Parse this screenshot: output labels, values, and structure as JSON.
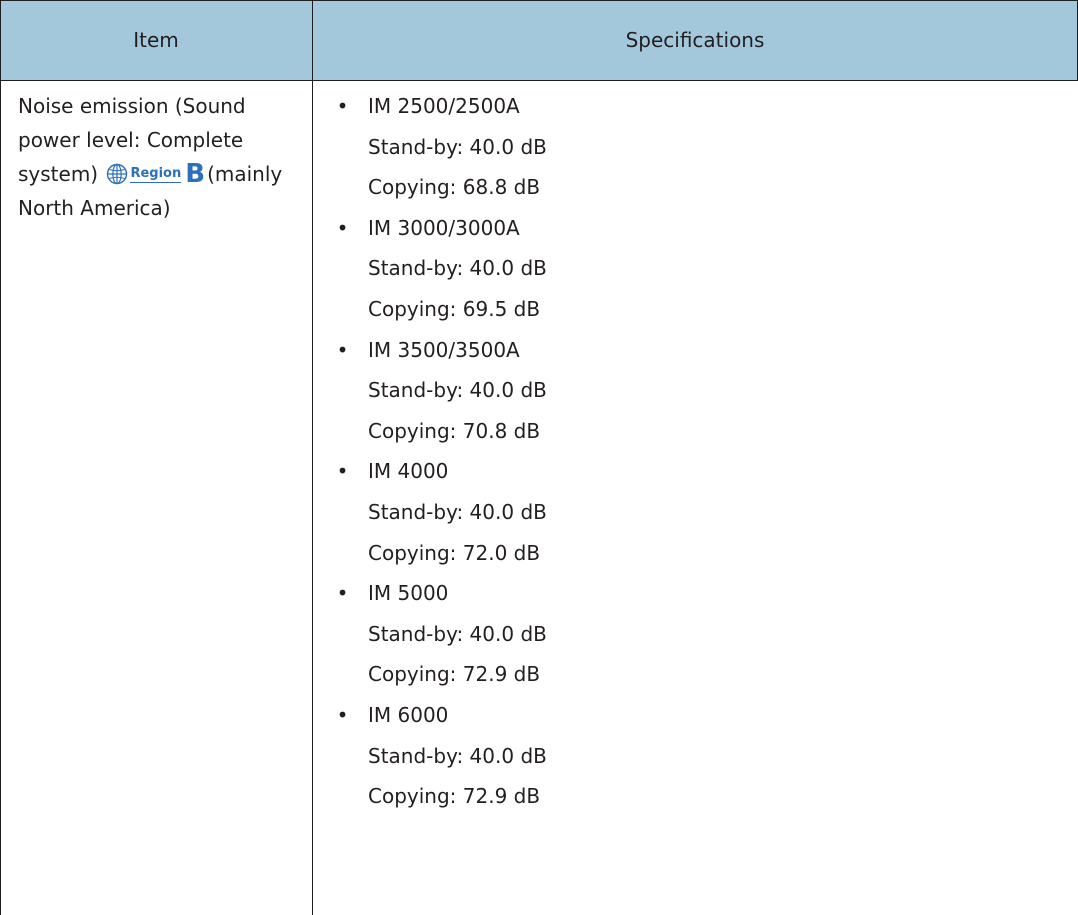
{
  "table": {
    "header": {
      "item": "Item",
      "specifications": "Specifications"
    },
    "item": {
      "lines": [
        "Noise emission (Sound",
        "power level: Complete"
      ],
      "before_badge": "system)",
      "region_word": "Region",
      "region_letter": "B",
      "after_badge": "(mainly",
      "last_line": "North America)",
      "region_color": "#2c6fbb"
    },
    "bullet": "•",
    "models": [
      {
        "model": "IM 2500/2500A",
        "standby": "Stand-by: 40.0 dB",
        "copying": "Copying: 68.8 dB"
      },
      {
        "model": "IM 3000/3000A",
        "standby": "Stand-by: 40.0 dB",
        "copying": "Copying: 69.5 dB"
      },
      {
        "model": "IM 3500/3500A",
        "standby": "Stand-by: 40.0 dB",
        "copying": "Copying: 70.8 dB"
      },
      {
        "model": "IM 4000",
        "standby": "Stand-by: 40.0 dB",
        "copying": "Copying: 72.0 dB"
      },
      {
        "model": "IM 5000",
        "standby": "Stand-by: 40.0 dB",
        "copying": "Copying: 72.9 dB"
      },
      {
        "model": "IM 6000",
        "standby": "Stand-by: 40.0 dB",
        "copying": "Copying: 72.9 dB"
      }
    ],
    "header_color": "#a3c8dc"
  }
}
